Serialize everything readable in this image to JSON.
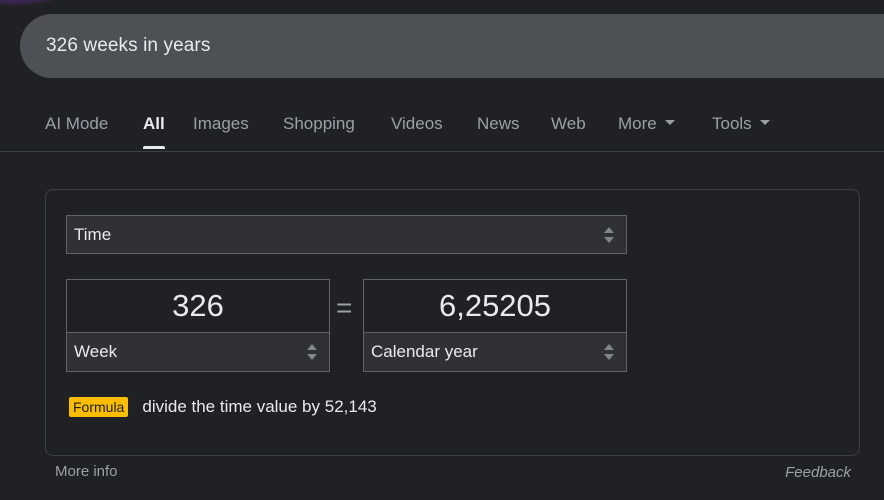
{
  "search": {
    "query": "326 weeks in years"
  },
  "tabs": [
    {
      "label": "AI Mode"
    },
    {
      "label": "All"
    },
    {
      "label": "Images"
    },
    {
      "label": "Shopping"
    },
    {
      "label": "Videos"
    },
    {
      "label": "News"
    },
    {
      "label": "Web"
    },
    {
      "label": "More"
    },
    {
      "label": "Tools"
    }
  ],
  "active_tab": "All",
  "converter": {
    "category": "Time",
    "from": {
      "value": "326",
      "unit": "Week"
    },
    "equals_sign": "=",
    "to": {
      "value": "6,25205",
      "unit": "Calendar year"
    },
    "formula_badge": "Formula",
    "formula_text": "divide the time value by 52,143"
  },
  "footer": {
    "more_info": "More info",
    "feedback": "Feedback"
  },
  "colors": {
    "background": "#202124",
    "search_bar": "#4d5156",
    "formula_badge": "#fbbc04"
  }
}
